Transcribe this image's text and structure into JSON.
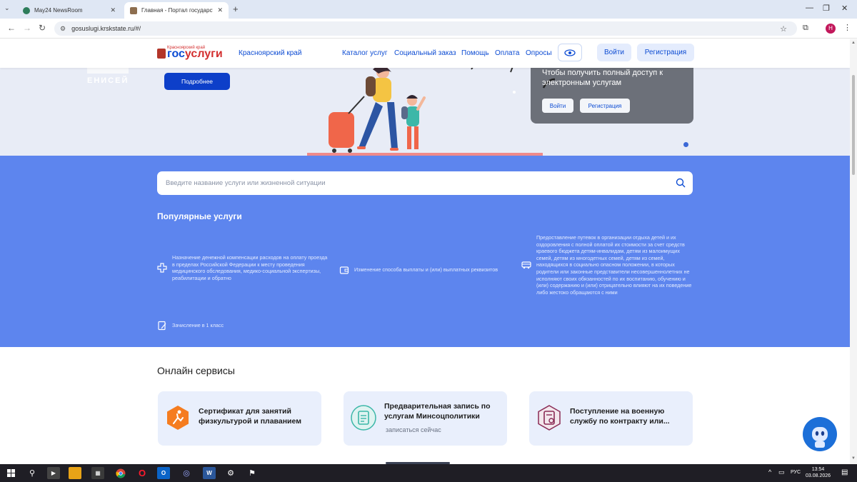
{
  "browser": {
    "tabs": [
      {
        "title": "May24 NewsRoom",
        "favicon_color": "#2e7d5b"
      },
      {
        "title": "Главная - Портал государстве",
        "favicon_color": "#8d6e4f"
      }
    ],
    "url": "gosuslugi.krskstate.ru/#/",
    "profile_initial": "Н"
  },
  "header": {
    "logo_sub": "Красноярский край",
    "logo_gos": "гос",
    "logo_uslugi": "услуги",
    "region": "Красноярский край",
    "nav": [
      "Каталог услуг",
      "Социальный заказ",
      "Помощь",
      "Оплата",
      "Опросы"
    ],
    "login": "Войти",
    "register": "Регистрация"
  },
  "hero": {
    "brand": "ЕНИСЕЙ",
    "more_button": "Подробнее",
    "promo_text": "Чтобы получить полный доступ к электронным услугам",
    "promo_login": "Войти",
    "promo_register": "Регистрация"
  },
  "search": {
    "placeholder": "Введите название услуги или жизненной ситуации"
  },
  "popular": {
    "title": "Популярные услуги",
    "items": [
      {
        "text": "Назначение денежной компенсации расходов на оплату проезда в пределах Российской Федерации к месту проведения медицинского обследования, медико-социальной экспертизы, реабилитации и обратно",
        "icon": "medical-cross-icon"
      },
      {
        "text": "Изменение способа выплаты и (или) выплатных реквизитов",
        "icon": "wallet-icon"
      },
      {
        "text": "Предоставление путевок в организации отдыха детей и их оздоровления с полной оплатой их стоимости за счет средств краевого бюджета детям-инвалидам, детям из малоимущих семей, детям из многодетных семей, детям из семей, находящихся в социально опасном положении, в которых родители или законные представители несовершеннолетних не исполняют своих обязанностей по их воспитанию, обучению и (или) содержанию и (или) отрицательно влияют на их поведение либо жестоко обращаются с ними",
        "icon": "bus-icon"
      },
      {
        "text": "Зачисление в 1 класс",
        "icon": "document-pencil-icon"
      }
    ]
  },
  "online": {
    "title": "Онлайн сервисы",
    "cards": [
      {
        "title": "Сертификат для занятий физкультурой и плаванием",
        "subtitle": "",
        "icon": "sport-icon",
        "color": "#f57c1f"
      },
      {
        "title": "Предварительная запись по услугам Минсоцполитики",
        "subtitle": "записаться сейчас",
        "icon": "clipboard-icon",
        "color": "#3cb7a8"
      },
      {
        "title": "Поступление на военную службу по контракту или...",
        "subtitle": "",
        "icon": "military-document-icon",
        "color": "#8a2a55"
      }
    ]
  },
  "taskbar": {
    "lang": "РУС",
    "time": "13:54",
    "date": "03.08.2026"
  },
  "colors": {
    "brand_blue": "#0d4cd3",
    "search_bg": "#5d85ee",
    "hero_bg": "#e8ecf6"
  }
}
